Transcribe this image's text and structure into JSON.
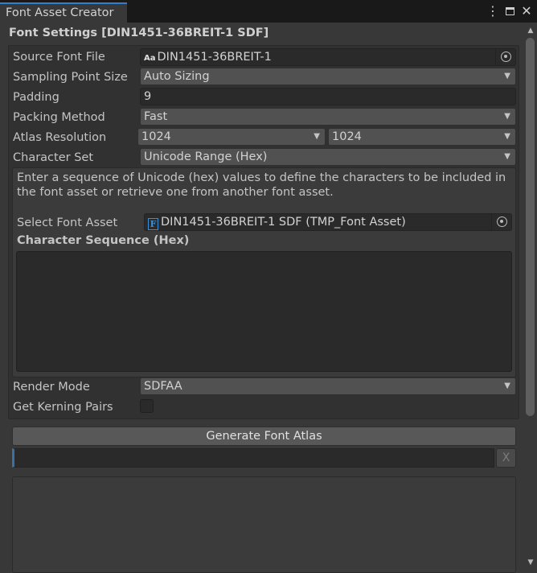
{
  "window": {
    "tab_title": "Font Asset Creator",
    "menu_icon": "kebab-menu-icon",
    "maximize_icon": "maximize-icon",
    "close_icon": "close-icon"
  },
  "header": {
    "title": "Font Settings [DIN1451-36BREIT-1 SDF]"
  },
  "fields": {
    "source_font_file": {
      "label": "Source Font File",
      "value": "DIN1451-36BREIT-1",
      "icon": "font-file-icon"
    },
    "sampling_point_size": {
      "label": "Sampling Point Size",
      "value": "Auto Sizing"
    },
    "padding": {
      "label": "Padding",
      "value": "9"
    },
    "packing_method": {
      "label": "Packing Method",
      "value": "Fast"
    },
    "atlas_resolution": {
      "label": "Atlas Resolution",
      "width": "1024",
      "height": "1024"
    },
    "character_set": {
      "label": "Character Set",
      "value": "Unicode Range (Hex)"
    }
  },
  "help_text": "Enter a sequence of Unicode (hex) values to define the characters to be included in the font asset or retrieve one from another font asset.",
  "select_font_asset": {
    "label": "Select Font Asset",
    "value": "DIN1451-36BREIT-1 SDF (TMP_Font Asset)",
    "icon": "font-asset-icon",
    "icon_glyph": "F"
  },
  "character_sequence": {
    "label": "Character Sequence (Hex)",
    "value": ""
  },
  "render_mode": {
    "label": "Render Mode",
    "value": "SDFAA"
  },
  "kerning": {
    "label": "Get Kerning Pairs",
    "checked": false
  },
  "generate_button": {
    "label": "Generate Font Atlas"
  },
  "clear_button": {
    "label": "X"
  },
  "colors": {
    "accent": "#2f7fd0",
    "background": "#383838",
    "field": "#2a2a2a",
    "dropdown": "#515151"
  }
}
